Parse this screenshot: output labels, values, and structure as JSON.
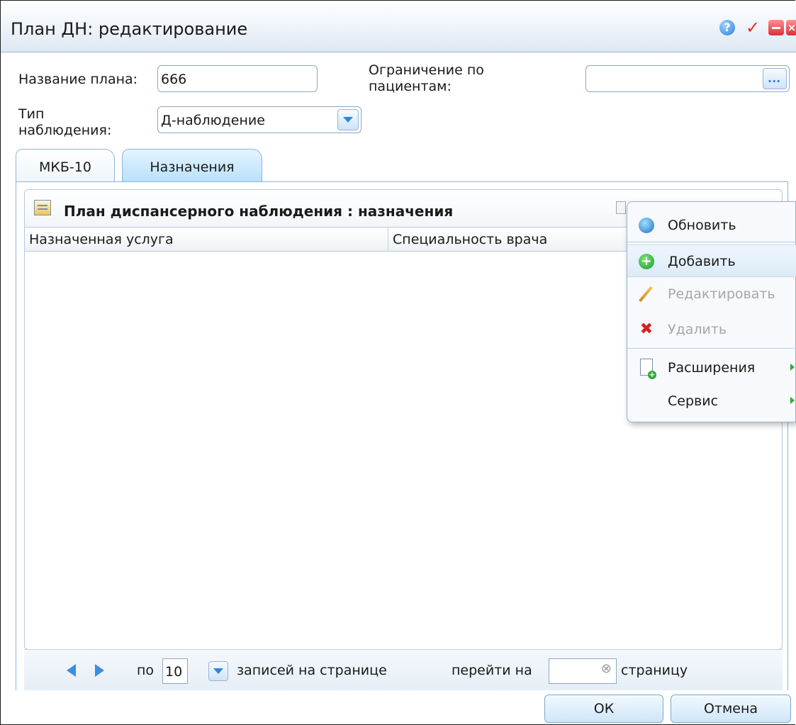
{
  "window": {
    "title": "План ДН: редактирование"
  },
  "form": {
    "plan_name_label": "Название плана:",
    "plan_name_value": "666",
    "patient_limit_label": "Ограничение по пациентам:",
    "patient_limit_value": "",
    "patient_limit_button": "...",
    "obs_type_label": "Тип наблюдения:",
    "obs_type_value": "Д-наблюдение"
  },
  "tabs": [
    {
      "label": "МКБ-10",
      "active": false
    },
    {
      "label": "Назначения",
      "active": true
    }
  ],
  "panel": {
    "title": "План диспансерного наблюдения : назначения",
    "columns": [
      "Назначенная услуга",
      "Специальность врача"
    ],
    "rows": []
  },
  "pager": {
    "per_label": "по",
    "page_size": "10",
    "per_page_suffix": "записей на странице",
    "goto_label": "перейти на",
    "goto_value": "",
    "goto_suffix": "страницу"
  },
  "context_menu": {
    "items": [
      {
        "label": "Обновить",
        "icon": "refresh-icon",
        "enabled": true
      },
      {
        "label": "Добавить",
        "icon": "add-icon",
        "enabled": true,
        "highlighted": true
      },
      {
        "label": "Редактировать",
        "icon": "pencil-icon",
        "enabled": false
      },
      {
        "label": "Удалить",
        "icon": "delete-icon",
        "enabled": false
      },
      {
        "label": "Расширения",
        "icon": "extensions-icon",
        "enabled": true,
        "submenu": true
      },
      {
        "label": "Сервис",
        "icon": "",
        "enabled": true,
        "submenu": true
      }
    ]
  },
  "buttons": {
    "ok": "ОК",
    "cancel": "Отмена"
  }
}
